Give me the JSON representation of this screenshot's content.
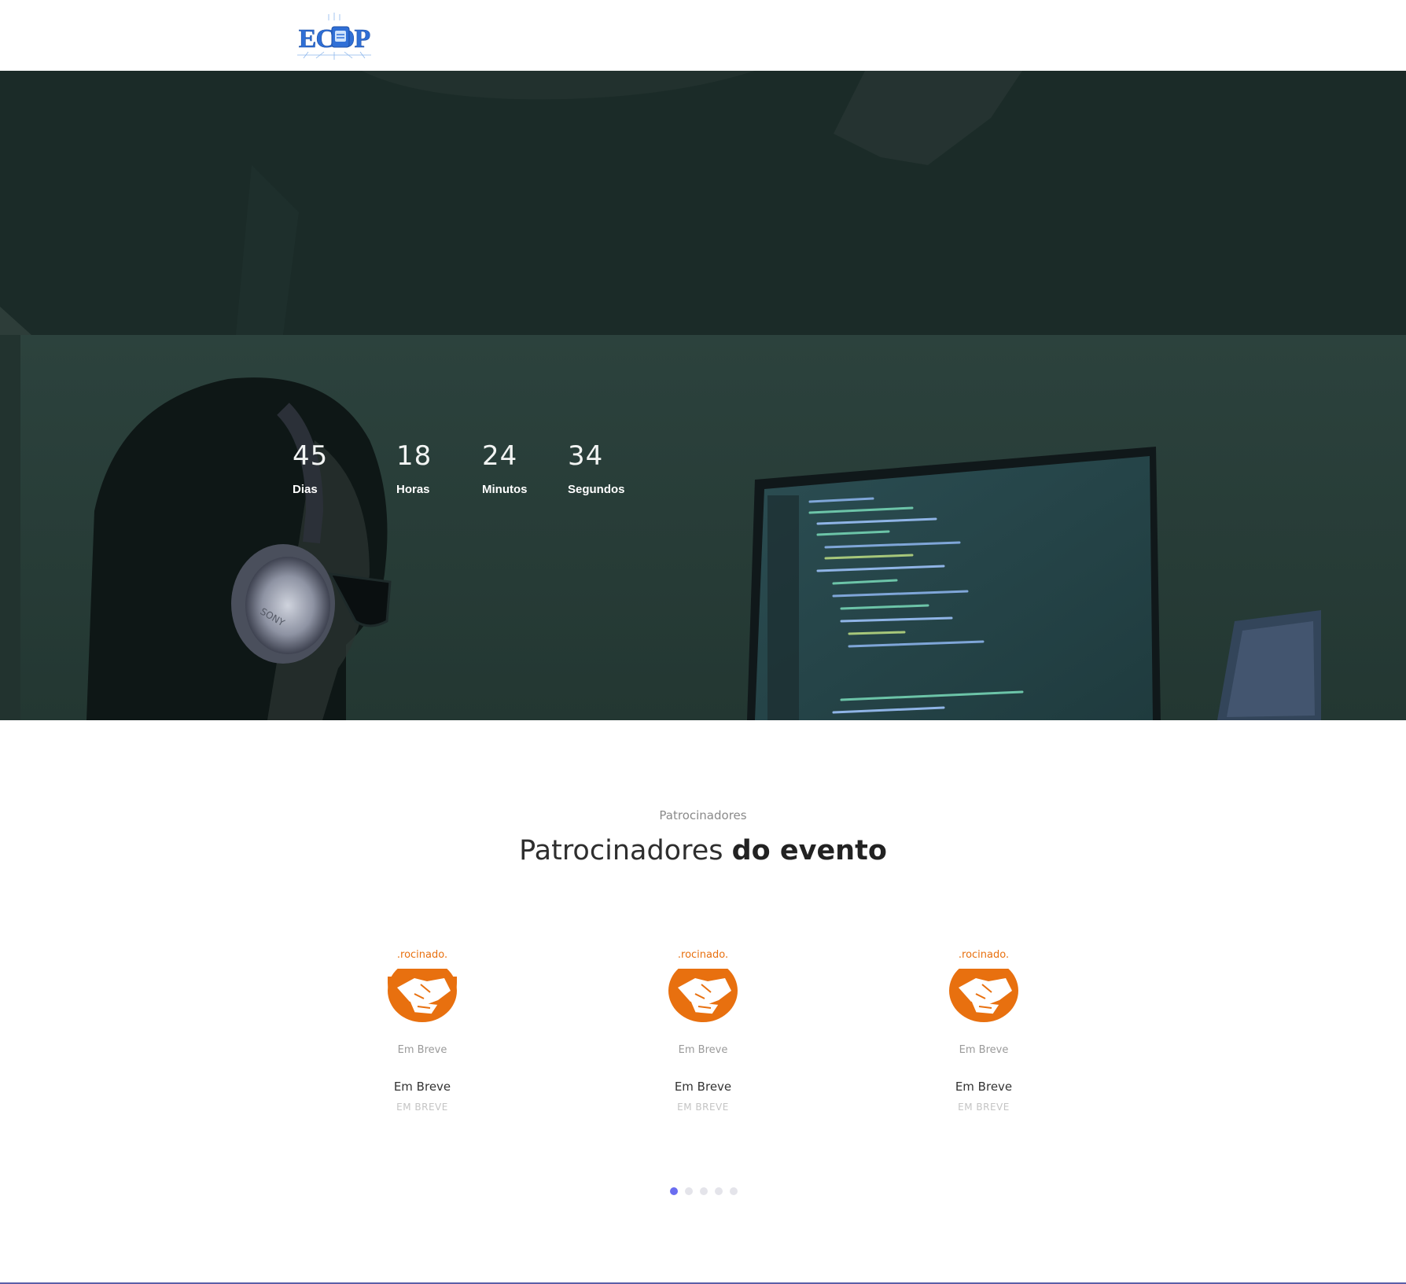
{
  "header": {
    "logo_text": "ECOP",
    "colors": {
      "logo_blue": "#2f6fd6",
      "logo_light": "#7fb2f0"
    }
  },
  "hero": {
    "icon": "hero-background-coder-image",
    "countdown": [
      {
        "value": "45",
        "label": "Dias"
      },
      {
        "value": "18",
        "label": "Horas"
      },
      {
        "value": "24",
        "label": "Minutos"
      },
      {
        "value": "34",
        "label": "Segundos"
      }
    ]
  },
  "sponsors": {
    "eyebrow": "Patrocinadores",
    "title_regular": "Patrocinadores",
    "title_bold": "do evento",
    "emblem_icon": "handshake-icon",
    "emblem_text": ".rocinado.",
    "accent_color": "#e8700f",
    "cards": [
      {
        "caption": "Em Breve",
        "name": "Em Breve",
        "role": "EM BREVE"
      },
      {
        "caption": "Em Breve",
        "name": "Em Breve",
        "role": "EM BREVE"
      },
      {
        "caption": "Em Breve",
        "name": "Em Breve",
        "role": "EM BREVE"
      }
    ],
    "pagination": {
      "count": 5,
      "active_index": 0,
      "active_color": "#6a6df0"
    }
  }
}
